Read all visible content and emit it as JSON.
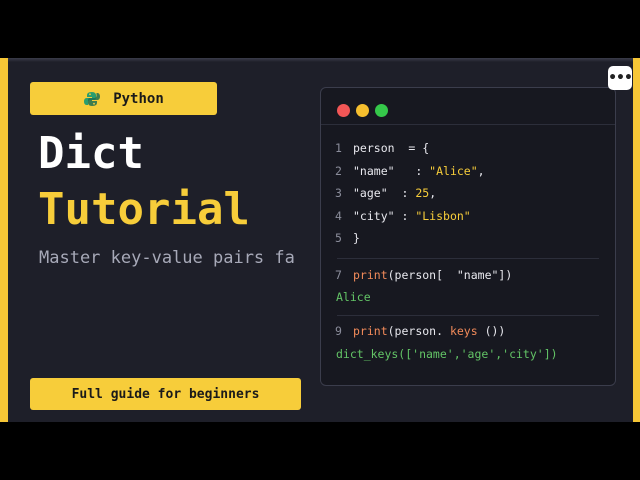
{
  "badge": {
    "label": "Python",
    "icon": "python-logo-icon"
  },
  "title": {
    "line1": "Dict",
    "line2": "Tutorial"
  },
  "subtitle": "Master key-value pairs fa",
  "footer_badge": {
    "label": "Full guide for beginners"
  },
  "menu_button": {
    "icon": "more-options-icon",
    "glyph": "•••"
  },
  "code_window": {
    "dots": [
      "red",
      "yellow",
      "green"
    ],
    "lines": [
      {
        "num": "1",
        "tokens": [
          {
            "text": "person",
            "cls": "c-white"
          },
          {
            "text": "  = {",
            "cls": "c-white"
          }
        ]
      },
      {
        "num": "2",
        "tokens": [
          {
            "text": "\"name\"",
            "cls": "c-white"
          },
          {
            "text": "   : ",
            "cls": "c-white"
          },
          {
            "text": "\"Alice\"",
            "cls": "c-str"
          },
          {
            "text": ",",
            "cls": "c-white"
          }
        ]
      },
      {
        "num": "3",
        "tokens": [
          {
            "text": "\"age\"",
            "cls": "c-white"
          },
          {
            "text": "  : ",
            "cls": "c-white"
          },
          {
            "text": "25",
            "cls": "c-num"
          },
          {
            "text": ",",
            "cls": "c-white"
          }
        ]
      },
      {
        "num": "4",
        "tokens": [
          {
            "text": "\"city\"",
            "cls": "c-white"
          },
          {
            "text": " : ",
            "cls": "c-white"
          },
          {
            "text": "\"Lisbon\"",
            "cls": "c-str"
          }
        ]
      },
      {
        "num": "5",
        "tokens": [
          {
            "text": "}",
            "cls": "c-white"
          }
        ]
      },
      {
        "num": "7",
        "tokens": [
          {
            "text": "print",
            "cls": "c-fn"
          },
          {
            "text": "(person[  ",
            "cls": "c-white"
          },
          {
            "text": "\"name\"",
            "cls": "c-white"
          },
          {
            "text": "])",
            "cls": "c-white"
          }
        ]
      },
      {
        "num": "",
        "tokens": [
          {
            "text": "Alice",
            "cls": "c-out"
          }
        ]
      },
      {
        "num": "9",
        "tokens": [
          {
            "text": "print",
            "cls": "c-fn"
          },
          {
            "text": "(person. ",
            "cls": "c-white"
          },
          {
            "text": "keys",
            "cls": "c-kw"
          },
          {
            "text": " ())",
            "cls": "c-white"
          }
        ]
      },
      {
        "num": "",
        "tokens": [
          {
            "text": "dict_keys(['name','age','city'])",
            "cls": "c-out"
          }
        ]
      }
    ]
  },
  "colors": {
    "accent": "#f7cd3a",
    "background": "#1e1f29",
    "code_background": "#171820",
    "string": "#f7cd3a",
    "function": "#f38b5a",
    "output": "#63c466"
  }
}
